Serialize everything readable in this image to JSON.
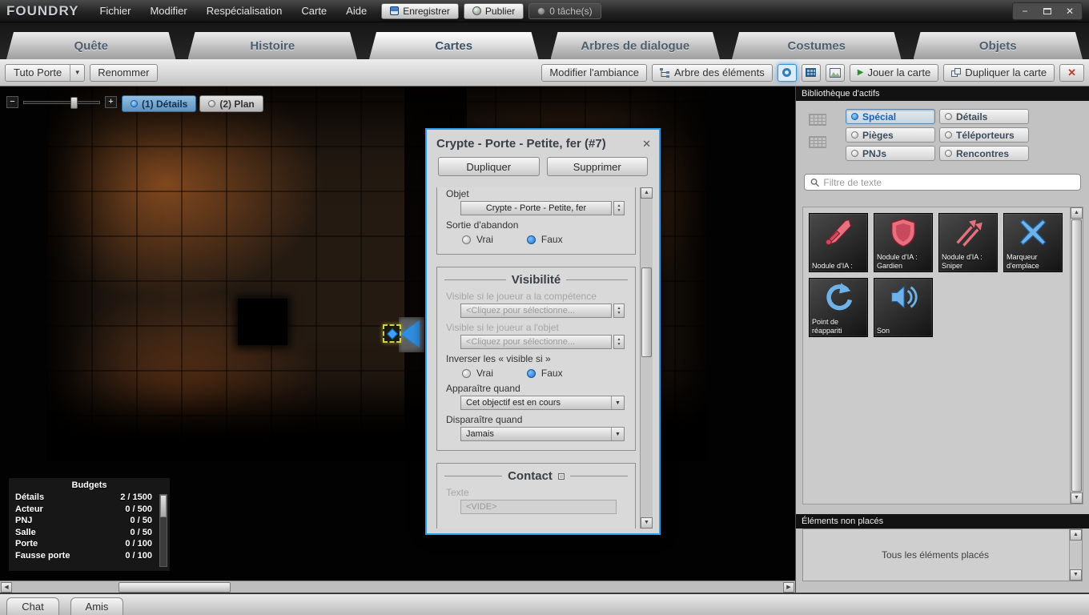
{
  "icons": {
    "minimize": "−",
    "close_window": "✕",
    "dialog_close": "✕",
    "close_red": "✕",
    "play": "▶",
    "combo_arrow": "▼",
    "dropdown": "▼",
    "spinner_up": "▲",
    "spinner_down": "▼",
    "scroll_up": "▲",
    "scroll_down": "▼",
    "scroll_left": "◀",
    "scroll_right": "▶",
    "zoom_out": "−",
    "zoom_in": "+"
  },
  "app": {
    "logo": "FOUNDRY",
    "menus": [
      "Fichier",
      "Modifier",
      "Respécialisation",
      "Carte",
      "Aide"
    ],
    "save_label": "Enregistrer",
    "publish_label": "Publier",
    "tasks_label": "0 tâche(s)"
  },
  "tabs": [
    {
      "label": "Quête"
    },
    {
      "label": "Histoire"
    },
    {
      "label": "Cartes"
    },
    {
      "label": "Arbres de dialogue"
    },
    {
      "label": "Costumes"
    },
    {
      "label": "Objets"
    }
  ],
  "toolbar": {
    "map_select": "Tuto Porte",
    "rename_label": "Renommer",
    "ambiance_label": "Modifier l'ambiance",
    "element_tree_label": "Arbre des éléments",
    "play_label": "Jouer la carte",
    "duplicate_label": "Dupliquer la carte"
  },
  "map_view": {
    "details_tab": "(1) Détails",
    "plan_tab": "(2) Plan"
  },
  "budgets": {
    "title": "Budgets",
    "rows": [
      {
        "name": "Détails",
        "value": "2 / 1500"
      },
      {
        "name": "Acteur",
        "value": "0 / 500"
      },
      {
        "name": "PNJ",
        "value": "0 / 50"
      },
      {
        "name": "Salle",
        "value": "0 / 50"
      },
      {
        "name": "Porte",
        "value": "0 / 100"
      },
      {
        "name": "Fausse porte",
        "value": "0 / 100"
      }
    ]
  },
  "dialog": {
    "title": "Crypte - Porte - Petite, fer (#7)",
    "duplicate_label": "Dupliquer",
    "delete_label": "Supprimer",
    "object_label": "Objet",
    "object_value": "Crypte - Porte - Petite, fer",
    "abandon_label": "Sortie d'abandon",
    "true_label": "Vrai",
    "false_label": "Faux",
    "visibility_title": "Visibilité",
    "visible_skill_label": "Visible si le joueur a la compétence",
    "visible_skill_value": "<Cliquez pour sélectionne...",
    "visible_object_label": "Visible si le joueur a l'objet",
    "visible_object_value": "<Cliquez pour sélectionne...",
    "invert_label": "Inverser les « visible si »",
    "appear_label": "Apparaître quand",
    "appear_value": "Cet objectif est en cours",
    "disappear_label": "Disparaître quand",
    "disappear_value": "Jamais",
    "contact_title": "Contact",
    "text_label": "Texte",
    "text_value": "<VIDE>"
  },
  "library": {
    "title": "Bibliothèque d'actifs",
    "categories": [
      {
        "label": "Spécial"
      },
      {
        "label": "Détails"
      },
      {
        "label": "Pièges"
      },
      {
        "label": "Téléporteurs"
      },
      {
        "label": "PNJs"
      },
      {
        "label": "Rencontres"
      }
    ],
    "filter_placeholder": "Filtre de texte",
    "assets": [
      {
        "label": "Nodule d'IA :"
      },
      {
        "label": "Nodule d'IA : Gardien"
      },
      {
        "label": "Nodule d'IA : Sniper"
      },
      {
        "label": "Marqueur d'emplace"
      },
      {
        "label": "Point de réappariti"
      },
      {
        "label": "Son"
      }
    ],
    "unplaced_title": "Éléments non placés",
    "unplaced_text": "Tous les éléments placés"
  },
  "bottom": {
    "chat_label": "Chat",
    "friends_label": "Amis"
  }
}
